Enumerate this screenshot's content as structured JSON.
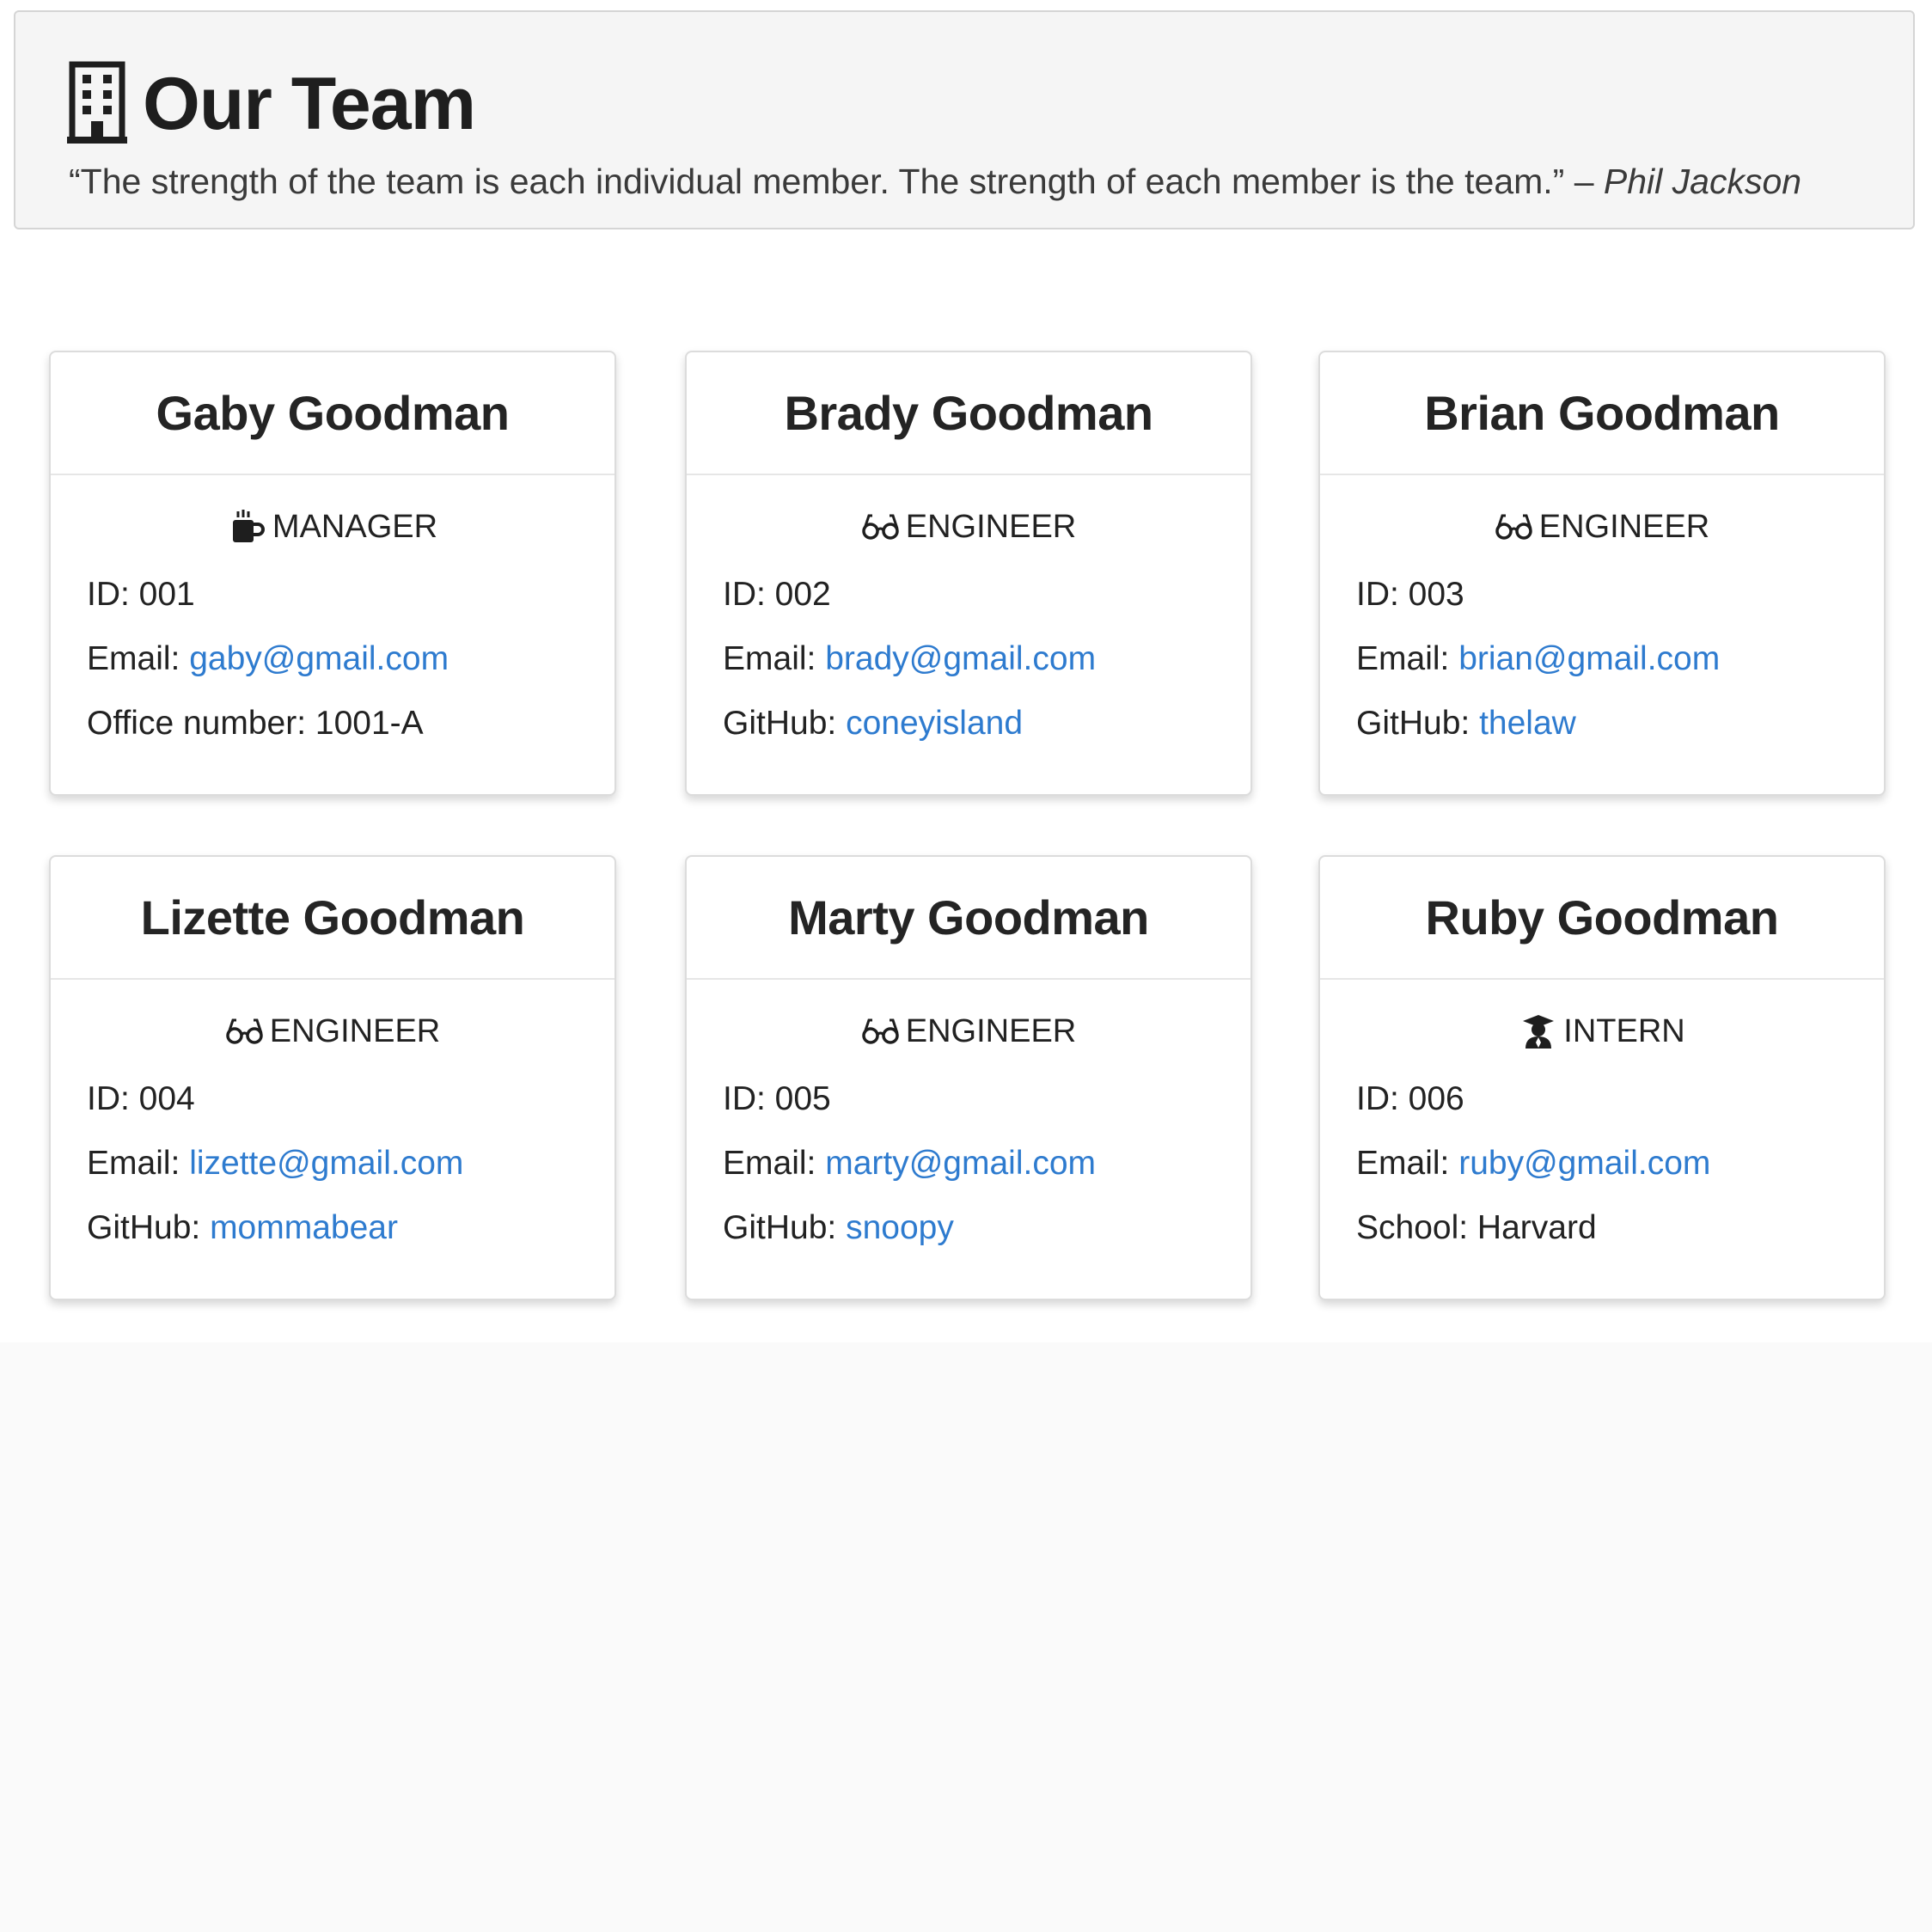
{
  "header": {
    "title": "Our Team",
    "quote": "“The strength of the team is each individual member. The strength of each member is the team.” – ",
    "quote_author": "Phil Jackson"
  },
  "colors": {
    "link": "#2e7bcf",
    "jumbotron_bg": "#f5f5f5"
  },
  "labels": {
    "id": "ID: ",
    "email": "Email: ",
    "github": "GitHub: ",
    "office": "Office number: ",
    "school": "School: "
  },
  "members": [
    {
      "name": "Gaby Goodman",
      "role": "MANAGER",
      "role_icon": "coffee-mug-icon",
      "id": "001",
      "email": "gaby@gmail.com",
      "extra_label": "Office number: ",
      "extra_value": "1001-A"
    },
    {
      "name": "Brady Goodman",
      "role": "ENGINEER",
      "role_icon": "glasses-icon",
      "id": "002",
      "email": "brady@gmail.com",
      "extra_label": "GitHub: ",
      "extra_value": "coneyisland"
    },
    {
      "name": "Brian Goodman",
      "role": "ENGINEER",
      "role_icon": "glasses-icon",
      "id": "003",
      "email": "brian@gmail.com",
      "extra_label": "GitHub: ",
      "extra_value": "thelaw"
    },
    {
      "name": "Lizette Goodman",
      "role": "ENGINEER",
      "role_icon": "glasses-icon",
      "id": "004",
      "email": "lizette@gmail.com",
      "extra_label": "GitHub: ",
      "extra_value": "mommabear"
    },
    {
      "name": "Marty Goodman",
      "role": "ENGINEER",
      "role_icon": "glasses-icon",
      "id": "005",
      "email": "marty@gmail.com",
      "extra_label": "GitHub: ",
      "extra_value": "snoopy"
    },
    {
      "name": "Ruby Goodman",
      "role": "INTERN",
      "role_icon": "graduate-icon",
      "id": "006",
      "email": "ruby@gmail.com",
      "extra_label": "School: ",
      "extra_value": "Harvard"
    }
  ]
}
